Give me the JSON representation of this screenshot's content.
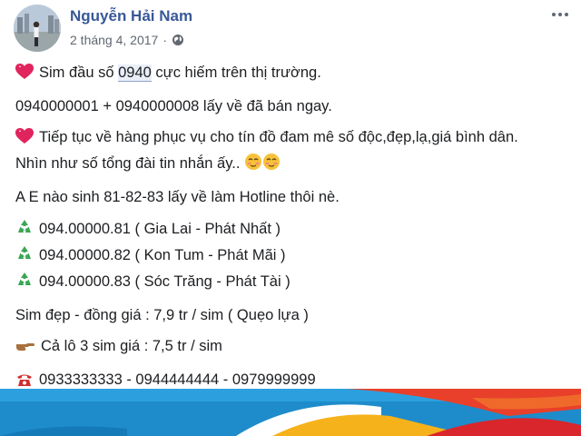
{
  "post": {
    "author": "Nguyễn Hải Nam",
    "date": "2 tháng 4, 2017",
    "separator": "·",
    "audience_icon": "globe-icon",
    "menu_icon": "more-options-icon"
  },
  "content": {
    "line1_pre": "Sim đầu số ",
    "line1_highlight": "0940",
    "line1_post": " cực hiếm trên thị trường.",
    "line2": "0940000001 + 0940000008 lấy về đã bán ngay.",
    "line3": "Tiếp tục về hàng phục vụ cho tín đồ đam mê số độc,đẹp,lạ,giá bình dân.",
    "line4": "Nhìn như số tổng đài tin nhắn ấy..",
    "line5": "A E nào sinh 81-82-83 lấy về làm Hotline thôi nè.",
    "sims": [
      "094.00000.81 ( Gia Lai - Phát Nhất )",
      "094.00000.82 ( Kon Tum - Phát Mãi )",
      "094.00000.83 ( Sóc Trăng - Phát Tài )"
    ],
    "price_same": "Sim đẹp - đồng giá : 7,9 tr / sim ( Quẹo lựa )",
    "price_lot": "Cả lô 3 sim giá : 7,5 tr / sim",
    "phones": "0933333333 - 0944444444 - 0979999999"
  },
  "icons": {
    "heart": "sparkling-heart-icon",
    "recycle": "recycle-icon",
    "hand": "pointing-hand-icon",
    "phone": "telephone-icon",
    "face": "relieved-face-icon"
  },
  "colors": {
    "author": "#385898",
    "meta": "#606770",
    "text": "#1c1e21",
    "heart": "#e0245e",
    "recycle": "#3aa655",
    "phone": "#d32f2f"
  }
}
